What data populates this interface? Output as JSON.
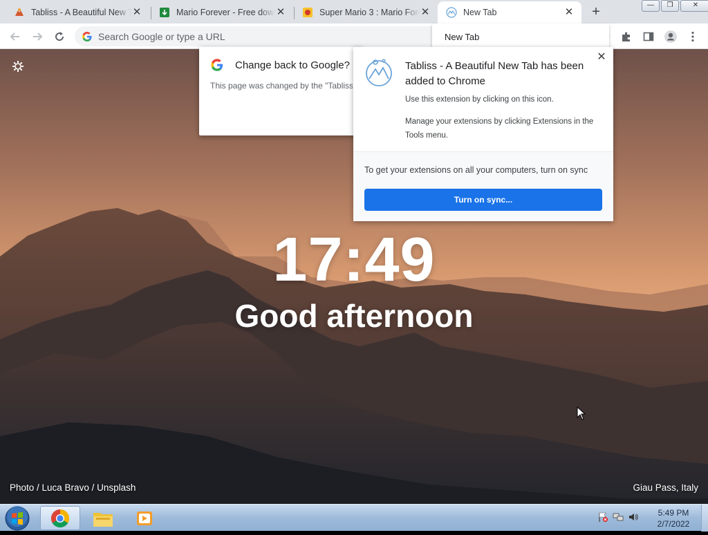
{
  "tabs": [
    {
      "title": "Tabliss - A Beautiful New Tab",
      "favicon": "tabliss-fox-icon"
    },
    {
      "title": "Mario Forever - Free download",
      "favicon": "download-green-icon"
    },
    {
      "title": "Super Mario 3 : Mario Forever",
      "favicon": "mario-game-icon"
    },
    {
      "title": "New Tab",
      "favicon": "tabliss-mountain-icon"
    }
  ],
  "new_tab_button": "+",
  "window_buttons": {
    "minimize": "—",
    "restore": "❐",
    "close": "✕"
  },
  "omnibox": {
    "placeholder": "Search Google or type a URL"
  },
  "omnibox_dropdown": {
    "label": "New Tab"
  },
  "google_popup": {
    "title": "Change back to Google?",
    "body": "This page was changed by the \"Tabliss"
  },
  "extension_popup": {
    "title": "Tabliss - A Beautiful New Tab has been added to Chrome",
    "line1": "Use this extension by clicking on this icon.",
    "line2": "Manage your extensions by clicking Extensions in the Tools menu.",
    "sync_text": "To get your extensions on all your computers, turn on sync",
    "sync_button": "Turn on sync...",
    "close": "✕"
  },
  "newtab_page": {
    "time": "17:49",
    "greeting": "Good afternoon",
    "photo_credit": "Photo / Luca Bravo / Unsplash",
    "location": "Giau Pass, Italy"
  },
  "taskbar": {
    "time": "5:49 PM",
    "date": "2/7/2022"
  },
  "colors": {
    "accent": "#1a73e8",
    "tabstrip": "#dee1e6",
    "sky_top": "#7f5f52",
    "sky_bottom": "#e6a476"
  }
}
